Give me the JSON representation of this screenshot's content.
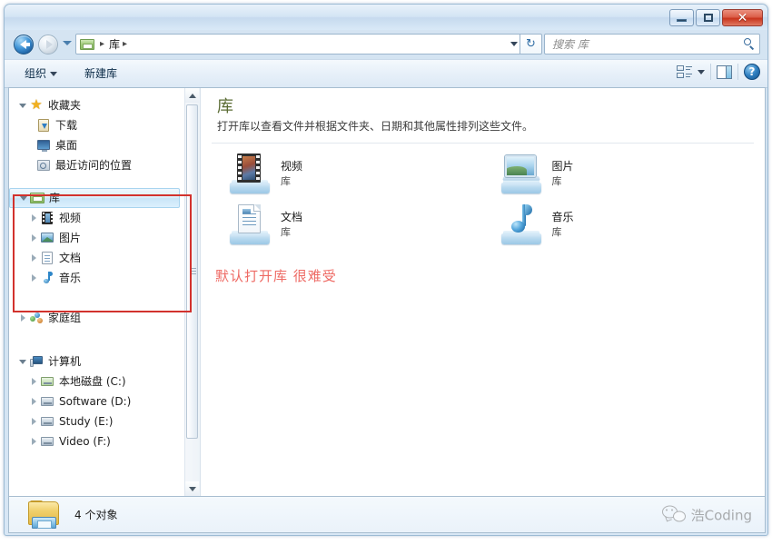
{
  "window": {
    "minimize_label": "–",
    "maximize_label": "□",
    "close_label": "✕"
  },
  "nav": {
    "back_title": "后退",
    "forward_title": "前进",
    "recent_title": "最近浏览的位置",
    "breadcrumb": [
      "库"
    ],
    "separator": "▸",
    "refresh_icon": "↻"
  },
  "search": {
    "placeholder": "搜索 库"
  },
  "commandbar": {
    "organize_label": "组织",
    "new_library_label": "新建库",
    "help_label": "?"
  },
  "sidebar": {
    "groups": [
      {
        "name": "收藏夹",
        "icon": "star-icon",
        "expander": "open",
        "children": [
          {
            "label": "下载",
            "icon": "download-icon",
            "expander": "none"
          },
          {
            "label": "桌面",
            "icon": "desktop-icon",
            "expander": "none"
          },
          {
            "label": "最近访问的位置",
            "icon": "recent-places-icon",
            "expander": "none"
          }
        ]
      },
      {
        "name": "库",
        "icon": "library-icon",
        "expander": "open",
        "selected": true,
        "children": [
          {
            "label": "视频",
            "icon": "video-icon",
            "expander": "closed"
          },
          {
            "label": "图片",
            "icon": "pictures-icon",
            "expander": "closed"
          },
          {
            "label": "文档",
            "icon": "documents-icon",
            "expander": "closed"
          },
          {
            "label": "音乐",
            "icon": "music-icon",
            "expander": "closed"
          }
        ]
      },
      {
        "name": "家庭组",
        "icon": "homegroup-icon",
        "expander": "closed",
        "children": []
      },
      {
        "name": "计算机",
        "icon": "computer-icon",
        "expander": "open",
        "children": [
          {
            "label": "本地磁盘 (C:)",
            "icon": "drive-icon",
            "expander": "closed"
          },
          {
            "label": "Software (D:)",
            "icon": "drive-icon",
            "expander": "closed"
          },
          {
            "label": "Study (E:)",
            "icon": "drive-icon",
            "expander": "closed"
          },
          {
            "label": "Video (F:)",
            "icon": "drive-icon",
            "expander": "closed"
          }
        ]
      }
    ]
  },
  "content": {
    "title": "库",
    "subtitle": "打开库以查看文件并根据文件夹、日期和其他属性排列这些文件。",
    "tiles": [
      {
        "name": "视频",
        "kind": "库",
        "icon": "video-library-icon"
      },
      {
        "name": "图片",
        "kind": "库",
        "icon": "pictures-library-icon"
      },
      {
        "name": "文档",
        "kind": "库",
        "icon": "documents-library-icon"
      },
      {
        "name": "音乐",
        "kind": "库",
        "icon": "music-library-icon"
      }
    ],
    "annotation": "默认打开库  很难受"
  },
  "status": {
    "item_count_text": "4 个对象"
  },
  "watermark": {
    "text": "浩Coding"
  },
  "colors": {
    "annotation_red": "#ee6a64",
    "highlight_box_red": "#d2322d",
    "content_title_green": "#5a6b33",
    "close_button_red": "#c8341d"
  }
}
